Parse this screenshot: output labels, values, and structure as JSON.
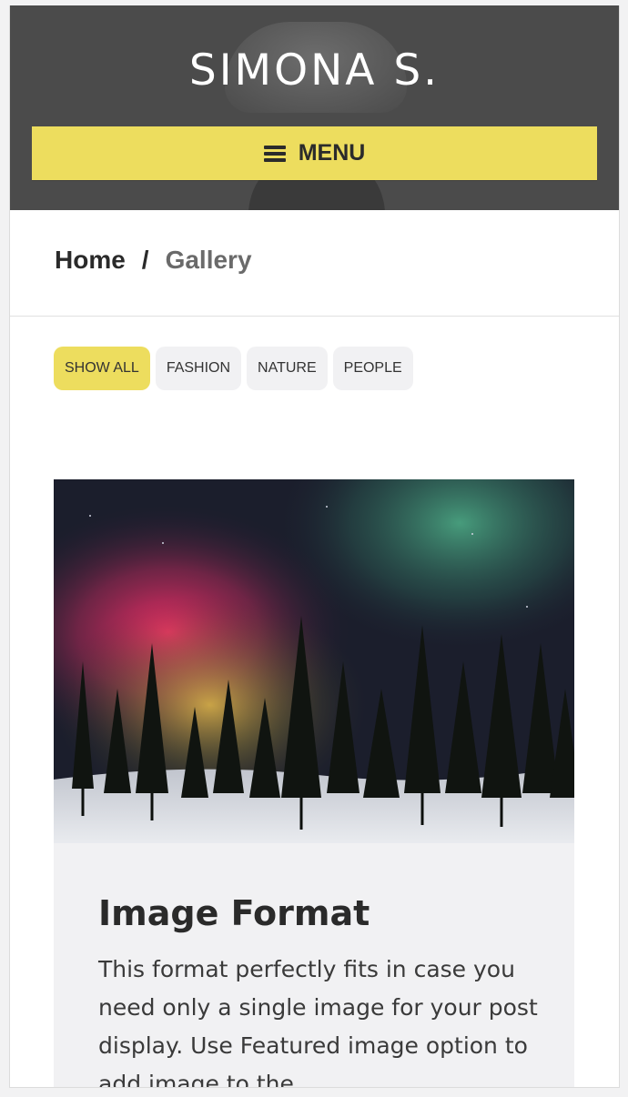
{
  "header": {
    "site_title": "SIMONA S.",
    "menu_label": "MENU"
  },
  "breadcrumb": {
    "home": "Home",
    "separator": "/",
    "current": "Gallery"
  },
  "filters": [
    {
      "label": "SHOW ALL",
      "active": true
    },
    {
      "label": "FASHION",
      "active": false
    },
    {
      "label": "NATURE",
      "active": false
    },
    {
      "label": "PEOPLE",
      "active": false
    }
  ],
  "post": {
    "title": "Image Format",
    "excerpt": "This format perfectly fits in case you need only a single image for your post display. Use Featured image option to add image to the"
  },
  "colors": {
    "accent": "#eddd5e",
    "header_bg": "#4b4b4b",
    "filter_bg": "#f1f1f3",
    "card_bg": "#f1f1f3"
  },
  "icons": {
    "menu": "hamburger-icon"
  }
}
